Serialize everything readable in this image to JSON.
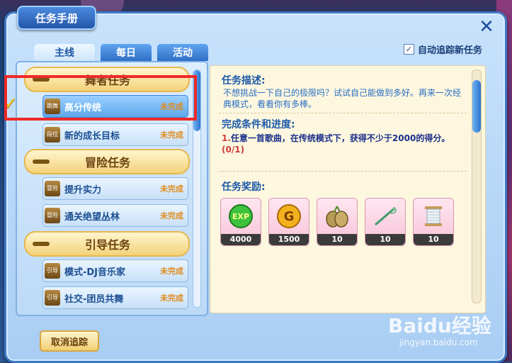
{
  "window": {
    "title": "任务手册",
    "close_symbol": "✕"
  },
  "tabs": [
    {
      "label": "主线",
      "active": true
    },
    {
      "label": "每日",
      "active": false
    },
    {
      "label": "活动",
      "active": false
    }
  ],
  "auto_track": {
    "label": "自动追踪新任务",
    "checked": true
  },
  "categories": [
    {
      "label": "舞者任务"
    },
    {
      "label": "冒险任务"
    },
    {
      "label": "引导任务"
    }
  ],
  "quests": [
    {
      "icon_text": "跳舞",
      "name": "高分传统",
      "status": "未完成",
      "selected": true
    },
    {
      "icon_text": "段位",
      "name": "新的成长目标",
      "status": "未完成",
      "selected": false
    },
    {
      "icon_text": "冒险",
      "name": "提升实力",
      "status": "未完成",
      "selected": false
    },
    {
      "icon_text": "冒险",
      "name": "通关绝望丛林",
      "status": "未完成",
      "selected": false
    },
    {
      "icon_text": "引导",
      "name": "模式-DJ音乐家",
      "status": "未完成",
      "selected": false
    },
    {
      "icon_text": "引导",
      "name": "社交-团员共舞",
      "status": "未完成",
      "selected": false
    }
  ],
  "detail": {
    "desc_title": "任务描述:",
    "desc_text": "不想挑战一下自己的极限吗？试试自己能做到多好。再来一次经典模式，看看你有多棒。",
    "cond_title": "完成条件和进度:",
    "cond_num": "1.",
    "cond_text": "任意一首歌曲，在传统模式下，获得不少于2000的得分。",
    "cond_progress": "(0/1)",
    "reward_title": "任务奖励:",
    "rewards": [
      {
        "icon": "exp-icon",
        "label": "EXP",
        "qty": "4000"
      },
      {
        "icon": "gold-coin-icon",
        "label": "G",
        "qty": "1500"
      },
      {
        "icon": "seed-pod-icon",
        "label": "",
        "qty": "10"
      },
      {
        "icon": "needle-icon",
        "label": "",
        "qty": "10"
      },
      {
        "icon": "thread-spool-icon",
        "label": "",
        "qty": "10"
      }
    ]
  },
  "footer": {
    "cancel_label": "取消追踪"
  },
  "watermark": {
    "line1": "Baidu经验",
    "line2": "jingyan.baidu.com"
  },
  "colors": {
    "accent": "#2c74cf",
    "status": "#e08c1e",
    "highlight": "#ee2a2a"
  }
}
